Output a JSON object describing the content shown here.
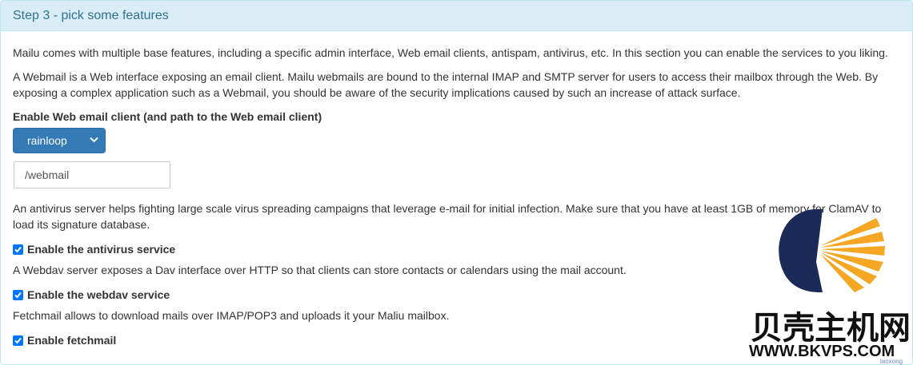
{
  "panel": {
    "title": "Step 3 - pick some features"
  },
  "intro": "Mailu comes with multiple base features, including a specific admin interface, Web email clients, antispam, antivirus, etc. In this section you can enable the services to you liking.",
  "webmail_desc": "A Webmail is a Web interface exposing an email client. Mailu webmails are bound to the internal IMAP and SMTP server for users to access their mailbox through the Web. By exposing a complex application such as a Webmail, you should be aware of the security implications caused by such an increase of attack surface.",
  "webmail": {
    "label": "Enable Web email client (and path to the Web email client)",
    "selected": "rainloop",
    "path_value": "/webmail"
  },
  "antivirus_desc": "An antivirus server helps fighting large scale virus spreading campaigns that leverage e-mail for initial infection. Make sure that you have at least 1GB of memory for ClamAV to load its signature database.",
  "antivirus": {
    "label": "Enable the antivirus service",
    "checked": true
  },
  "webdav_desc": "A Webdav server exposes a Dav interface over HTTP so that clients can store contacts or calendars using the mail account.",
  "webdav": {
    "label": "Enable the webdav service",
    "checked": true
  },
  "fetchmail_desc": "Fetchmail allows to download mails over IMAP/POP3 and uploads it your Maliu mailbox.",
  "fetchmail": {
    "label": "Enable fetchmail",
    "checked": true
  },
  "watermark": {
    "name": "贝壳主机网",
    "url": "WWW.BKVPS.COM",
    "small": "laoxong"
  },
  "colors": {
    "heading_bg": "#d9edf7",
    "heading_text": "#31708f",
    "select_bg": "#337ab7",
    "checkbox": "#0075ff",
    "logo_navy": "#1a2b57",
    "logo_orange": "#f5a623"
  }
}
